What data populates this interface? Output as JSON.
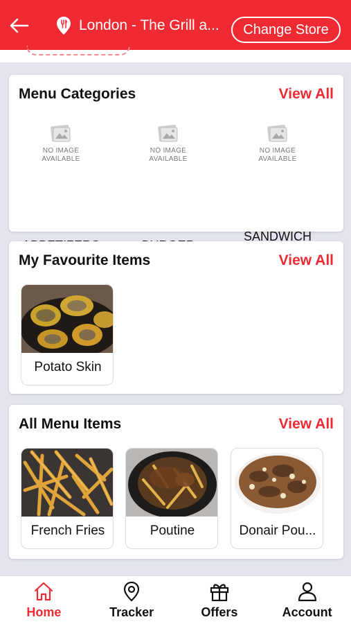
{
  "colors": {
    "brand": "#ef2a33",
    "background": "#e3e4ee",
    "card": "#ffffff"
  },
  "header": {
    "back_icon": "arrow-left-icon",
    "store_icon": "location-pin-icon",
    "store_name": "London - The Grill a...",
    "change_store_label": "Change Store"
  },
  "categories": {
    "title": "Menu Categories",
    "view_all": "View All",
    "no_image_text": "NO IMAGE AVAILABLE",
    "items": [
      {
        "label": "APPETIZERS"
      },
      {
        "label": "BURGER"
      },
      {
        "label": "SANDWICH & WRAP"
      }
    ]
  },
  "favourites": {
    "title": "My Favourite Items",
    "view_all": "View All",
    "items": [
      {
        "label": "Potato Skin"
      }
    ]
  },
  "all_items": {
    "title": "All Menu Items",
    "view_all": "View All",
    "items": [
      {
        "label": "French Fries"
      },
      {
        "label": "Poutine"
      },
      {
        "label": "Donair Pou..."
      }
    ]
  },
  "nav": {
    "items": [
      {
        "label": "Home",
        "icon": "home-icon",
        "active": true
      },
      {
        "label": "Tracker",
        "icon": "location-pin-icon",
        "active": false
      },
      {
        "label": "Offers",
        "icon": "gift-icon",
        "active": false
      },
      {
        "label": "Account",
        "icon": "user-icon",
        "active": false
      }
    ]
  }
}
